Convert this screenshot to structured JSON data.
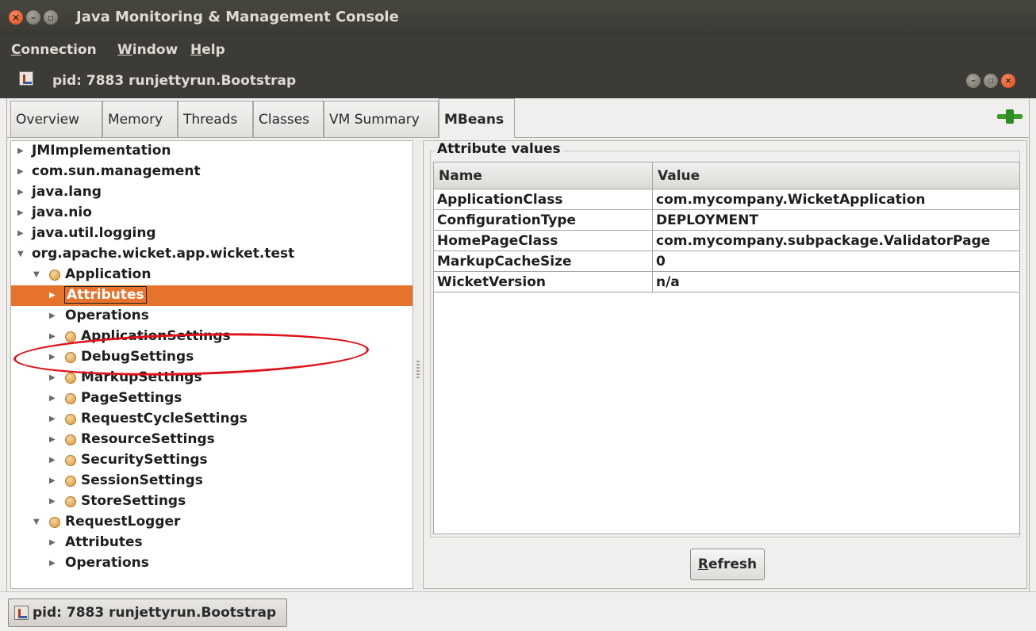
{
  "window": {
    "title": "Java Monitoring & Management Console"
  },
  "menu": {
    "items": [
      {
        "first": "C",
        "rest": "onnection"
      },
      {
        "first": "W",
        "rest": "indow"
      },
      {
        "first": "H",
        "rest": "elp"
      }
    ]
  },
  "frame": {
    "title": "pid: 7883 runjettyrun.Bootstrap"
  },
  "tabs": [
    "Overview",
    "Memory",
    "Threads",
    "Classes",
    "VM Summary",
    "MBeans"
  ],
  "active_tab": "MBeans",
  "tree": [
    {
      "label": "JMImplementation",
      "expanded": false,
      "icon": "none"
    },
    {
      "label": "com.sun.management",
      "expanded": false,
      "icon": "none"
    },
    {
      "label": "java.lang",
      "expanded": false,
      "icon": "none"
    },
    {
      "label": "java.nio",
      "expanded": false,
      "icon": "none"
    },
    {
      "label": "java.util.logging",
      "expanded": false,
      "icon": "none"
    },
    {
      "label": "org.apache.wicket.app.wicket.test",
      "expanded": true,
      "icon": "none",
      "highlighted": true
    },
    {
      "label": "Application",
      "expanded": true,
      "icon": "bean"
    },
    {
      "label": "Attributes",
      "expanded": false,
      "icon": "none",
      "selected": true
    },
    {
      "label": "Operations",
      "expanded": false,
      "icon": "none"
    },
    {
      "label": "ApplicationSettings",
      "expanded": false,
      "icon": "bean"
    },
    {
      "label": "DebugSettings",
      "expanded": false,
      "icon": "bean"
    },
    {
      "label": "MarkupSettings",
      "expanded": false,
      "icon": "bean"
    },
    {
      "label": "PageSettings",
      "expanded": false,
      "icon": "bean"
    },
    {
      "label": "RequestCycleSettings",
      "expanded": false,
      "icon": "bean"
    },
    {
      "label": "ResourceSettings",
      "expanded": false,
      "icon": "bean"
    },
    {
      "label": "SecuritySettings",
      "expanded": false,
      "icon": "bean"
    },
    {
      "label": "SessionSettings",
      "expanded": false,
      "icon": "bean"
    },
    {
      "label": "StoreSettings",
      "expanded": false,
      "icon": "bean"
    },
    {
      "label": "RequestLogger",
      "expanded": true,
      "icon": "bean"
    },
    {
      "label": "Attributes",
      "expanded": false,
      "icon": "none"
    },
    {
      "label": "Operations",
      "expanded": false,
      "icon": "none"
    }
  ],
  "attributes": {
    "group_title": "Attribute values",
    "columns": [
      "Name",
      "Value"
    ],
    "rows": [
      {
        "name": "ApplicationClass",
        "value": "com.mycompany.WicketApplication"
      },
      {
        "name": "ConfigurationType",
        "value": "DEPLOYMENT"
      },
      {
        "name": "HomePageClass",
        "value": "com.mycompany.subpackage.ValidatorPage"
      },
      {
        "name": "MarkupCacheSize",
        "value": "0"
      },
      {
        "name": "WicketVersion",
        "value": "n/a"
      }
    ],
    "refresh_first": "R",
    "refresh_rest": "efresh"
  },
  "taskbar": {
    "button_label": "pid: 7883 runjettyrun.Bootstrap"
  },
  "colors": {
    "selection": "#e6732b",
    "annotation": "#e0131b",
    "titlebar": "#3c3b37"
  }
}
